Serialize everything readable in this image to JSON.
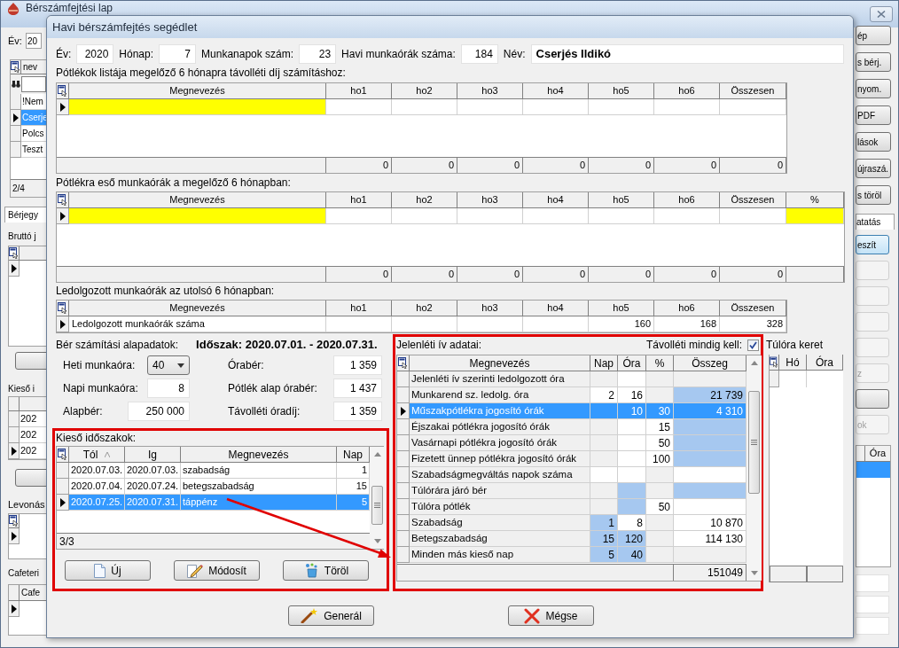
{
  "background_window": {
    "title": "Bérszámfejtési lap",
    "left": {
      "year_label": "Év:",
      "year_value": "20",
      "list_column": "nev",
      "list_rows": [
        {
          "text": "!Nem",
          "selected": false
        },
        {
          "text": "Cserje",
          "selected": true
        },
        {
          "text": "Polcs",
          "selected": false
        },
        {
          "text": "Teszt",
          "selected": false
        }
      ],
      "list_counter": "2/4",
      "tab": "Bérjegy",
      "gross_label": "Bruttó j",
      "absence_label": "Kieső i",
      "absence_rows": [
        {
          "text": "202",
          "selected": false
        },
        {
          "text": "202",
          "selected": false
        },
        {
          "text": "202",
          "selected": true
        }
      ],
      "deduction_label": "Levonás",
      "cafeteria_label": "Cafeteri",
      "cafeteria_column": "Cafe"
    },
    "right": {
      "buttons": [
        {
          "label": "ép"
        },
        {
          "label": "s bérj."
        },
        {
          "label": "nyom."
        },
        {
          "label": "PDF"
        },
        {
          "label": "lások"
        },
        {
          "label": "újraszá."
        },
        {
          "label": "s töröl"
        }
      ],
      "tab": "atatás",
      "actions": [
        {
          "label": "eszít",
          "disabled": false
        },
        {
          "disabled": true
        },
        {
          "disabled": true
        },
        {
          "disabled": true
        },
        {
          "disabled": true
        },
        {
          "label": "z",
          "disabled": true
        },
        {
          "disabled": false
        },
        {
          "label": "ok",
          "disabled": true
        }
      ],
      "table_column": "Óra",
      "table_rows": [
        {
          "selected": true
        }
      ]
    }
  },
  "dialog": {
    "title": "Havi bérszámfejtés segédlet",
    "header_fields": [
      {
        "label": "Év:",
        "value": "2020",
        "kind": "number"
      },
      {
        "label": "Hónap:",
        "value": "7",
        "kind": "number"
      },
      {
        "label": "Munkanapok szám:",
        "value": "23",
        "kind": "number"
      },
      {
        "label": "Havi munkaórák száma:",
        "value": "184",
        "kind": "number"
      },
      {
        "label": "Név:",
        "value": "Cserjés Ildikó",
        "kind": "name"
      }
    ],
    "grids": [
      {
        "caption": "Pótlékok listája megelőző 6 hónapra távolléti díj számításhoz:",
        "columns": [
          "Megnevezés",
          "ho1",
          "ho2",
          "ho3",
          "ho4",
          "ho5",
          "ho6",
          "Összesen"
        ],
        "rows": [
          {
            "selected": true,
            "cells": [
              {
                "color": "#ffff00"
              },
              {
                "color": "#ffffff"
              },
              {
                "color": "#ffffff"
              },
              {
                "color": "#ffffff"
              },
              {
                "color": "#ffffff"
              },
              {
                "color": "#ffffff"
              },
              {
                "color": "#ffffff"
              },
              {
                "color": "#ffffff"
              }
            ]
          }
        ],
        "footer": [
          "0",
          "0",
          "0",
          "0",
          "0",
          "0",
          "0"
        ]
      },
      {
        "caption": "Pótlékra eső munkaórák a megelőző 6 hónapban:",
        "columns": [
          "Megnevezés",
          "ho1",
          "ho2",
          "ho3",
          "ho4",
          "ho5",
          "ho6",
          "Összesen",
          "%"
        ],
        "rows": [
          {
            "selected": true,
            "cells": [
              {
                "color": "#ffff00"
              },
              {
                "color": "#ffffff"
              },
              {
                "color": "#ffffff"
              },
              {
                "color": "#ffffff"
              },
              {
                "color": "#ffffff"
              },
              {
                "color": "#ffffff"
              },
              {
                "color": "#ffffff"
              },
              {
                "color": "#ffffff"
              },
              {
                "color": "#ffff00"
              }
            ]
          }
        ],
        "footer": [
          "0",
          "0",
          "0",
          "0",
          "0",
          "0",
          "0"
        ]
      },
      {
        "caption": "Ledolgozott munkaórák az utolsó 6 hónapban:",
        "columns": [
          "Megnevezés",
          "ho1",
          "ho2",
          "ho3",
          "ho4",
          "ho5",
          "ho6",
          "Összesen"
        ],
        "rows": [
          {
            "selected": true,
            "cells": [
              {
                "value": "Ledolgozott munkaórák száma",
                "color": "#ffffff"
              },
              {
                "color": "#ffffff"
              },
              {
                "color": "#ffffff"
              },
              {
                "color": "#ffffff"
              },
              {
                "color": "#ffffff"
              },
              {
                "value": "160",
                "color": "#ffffff"
              },
              {
                "value": "168",
                "color": "#ffffff"
              },
              {
                "value": "328",
                "color": "#ffffff"
              }
            ]
          }
        ]
      }
    ],
    "basics": {
      "caption": "Bér számítási alapadatok:",
      "period": "Időszak: 2020.07.01. - 2020.07.31.",
      "left_fields": [
        {
          "label": "Heti munkaóra:",
          "value": "40",
          "kind": "dropdown"
        },
        {
          "label": "Napi munkaóra:",
          "value": "8",
          "kind": "text"
        },
        {
          "label": "Alapbér:",
          "value": "250 000",
          "kind": "wide"
        }
      ],
      "right_fields": [
        {
          "label": "Órabér:",
          "value": "1 359"
        },
        {
          "label": "Pótlék alap órabér:",
          "value": "1 437"
        },
        {
          "label": "Távolléti óradíj:",
          "value": "1 359"
        }
      ]
    },
    "absences": {
      "caption": "Kieső időszakok:",
      "columns": [
        {
          "label": "Tól",
          "sorted": true
        },
        {
          "label": "Ig",
          "sorted": false
        },
        {
          "label": "Megnevezés",
          "sorted": false
        },
        {
          "label": "Nap",
          "sorted": false
        }
      ],
      "rows": [
        {
          "selected": false,
          "cells": [
            "2020.07.03.",
            "2020.07.03.",
            "szabadság",
            "1"
          ]
        },
        {
          "selected": false,
          "cells": [
            "2020.07.04.",
            "2020.07.24.",
            "betegszabadság",
            "15"
          ]
        },
        {
          "selected": true,
          "cells": [
            "2020.07.25.",
            "2020.07.31.",
            "táppénz",
            "5"
          ]
        }
      ],
      "counter": "3/3",
      "buttons": [
        {
          "label": "Új",
          "kind": "new"
        },
        {
          "label": "Módosít",
          "kind": "edit"
        },
        {
          "label": "Töröl",
          "kind": "delete"
        }
      ]
    },
    "attendance": {
      "caption": "Jelenléti ív adatai:",
      "always_label": "Távolléti mindig kell:",
      "always_checked": true,
      "columns": [
        "Megnevezés",
        "Nap",
        "Óra",
        "%",
        "Összeg"
      ],
      "rows": [
        {
          "selected": false,
          "cells": [
            {
              "value": "Jelenléti ív szerinti ledolgozott óra",
              "color": "#f0f0f0"
            },
            {
              "color": "#f0f0f0"
            },
            {
              "color": "#ffffff"
            },
            {
              "color": "#f0f0f0"
            },
            {
              "color": "#f0f0f0"
            }
          ]
        },
        {
          "selected": false,
          "cells": [
            {
              "value": "Munkarend sz. ledolg. óra",
              "color": "#f0f0f0"
            },
            {
              "value": "2",
              "color": "#ffffff"
            },
            {
              "value": "16",
              "color": "#ffffff"
            },
            {
              "color": "#f0f0f0"
            },
            {
              "value": "21 739",
              "color": "#a6c8f0"
            }
          ]
        },
        {
          "selected": true,
          "cells": [
            {
              "value": "Műszakpótlékra jogosító órák",
              "color": "#3399ff"
            },
            {
              "color": "#3399ff"
            },
            {
              "value": "10",
              "color": "#3399ff"
            },
            {
              "value": "30",
              "color": "#3399ff"
            },
            {
              "value": "4 310",
              "color": "#3399ff"
            }
          ]
        },
        {
          "selected": false,
          "cells": [
            {
              "value": "Éjszakai pótlékra jogosító órák",
              "color": "#f0f0f0"
            },
            {
              "color": "#f0f0f0"
            },
            {
              "color": "#ffffff"
            },
            {
              "value": "15",
              "color": "#ffffff"
            },
            {
              "color": "#a6c8f0"
            }
          ]
        },
        {
          "selected": false,
          "cells": [
            {
              "value": "Vasárnapi pótlékra jogosító órák",
              "color": "#f0f0f0"
            },
            {
              "color": "#f0f0f0"
            },
            {
              "color": "#ffffff"
            },
            {
              "value": "50",
              "color": "#ffffff"
            },
            {
              "color": "#a6c8f0"
            }
          ]
        },
        {
          "selected": false,
          "cells": [
            {
              "value": "Fizetett ünnep pótlékra jogosító órák",
              "color": "#f0f0f0"
            },
            {
              "color": "#f0f0f0"
            },
            {
              "color": "#ffffff"
            },
            {
              "value": "100",
              "color": "#ffffff"
            },
            {
              "color": "#a6c8f0"
            }
          ]
        },
        {
          "selected": false,
          "cells": [
            {
              "value": "Szabadságmegváltás napok száma",
              "color": "#f0f0f0"
            },
            {
              "color": "#ffffff"
            },
            {
              "color": "#ffffff"
            },
            {
              "color": "#f0f0f0"
            },
            {
              "color": "#ffffff"
            }
          ]
        },
        {
          "selected": false,
          "cells": [
            {
              "value": "Túlórára járó bér",
              "color": "#f0f0f0"
            },
            {
              "color": "#f0f0f0"
            },
            {
              "color": "#a6c8f0"
            },
            {
              "color": "#f0f0f0"
            },
            {
              "color": "#a6c8f0"
            }
          ]
        },
        {
          "selected": false,
          "cells": [
            {
              "value": "Túlóra pótlék",
              "color": "#f0f0f0"
            },
            {
              "color": "#f0f0f0"
            },
            {
              "color": "#a6c8f0"
            },
            {
              "value": "50",
              "color": "#ffffff"
            },
            {
              "color": "#ffffff"
            }
          ]
        },
        {
          "selected": false,
          "cells": [
            {
              "value": "Szabadság",
              "color": "#f0f0f0"
            },
            {
              "value": "1",
              "color": "#a6c8f0"
            },
            {
              "value": "8",
              "color": "#ffffff"
            },
            {
              "color": "#f0f0f0"
            },
            {
              "value": "10 870",
              "color": "#ffffff"
            }
          ]
        },
        {
          "selected": false,
          "cells": [
            {
              "value": "Betegszabadság",
              "color": "#f0f0f0"
            },
            {
              "value": "15",
              "color": "#a6c8f0"
            },
            {
              "value": "120",
              "color": "#a6c8f0"
            },
            {
              "color": "#f0f0f0"
            },
            {
              "value": "114 130",
              "color": "#ffffff"
            }
          ]
        },
        {
          "selected": false,
          "cells": [
            {
              "value": "Minden más kieső nap",
              "color": "#f0f0f0"
            },
            {
              "value": "5",
              "color": "#a6c8f0"
            },
            {
              "value": "40",
              "color": "#a6c8f0"
            },
            {
              "color": "#f0f0f0"
            },
            {
              "color": "#f0f0f0"
            }
          ]
        }
      ],
      "total": "151049"
    },
    "overtime": {
      "caption": "Túlóra keret",
      "columns": [
        "Hó",
        "Óra"
      ]
    },
    "buttons": [
      {
        "label": "Generál",
        "kind": "generate"
      },
      {
        "label": "Mégse",
        "kind": "cancel"
      }
    ]
  }
}
